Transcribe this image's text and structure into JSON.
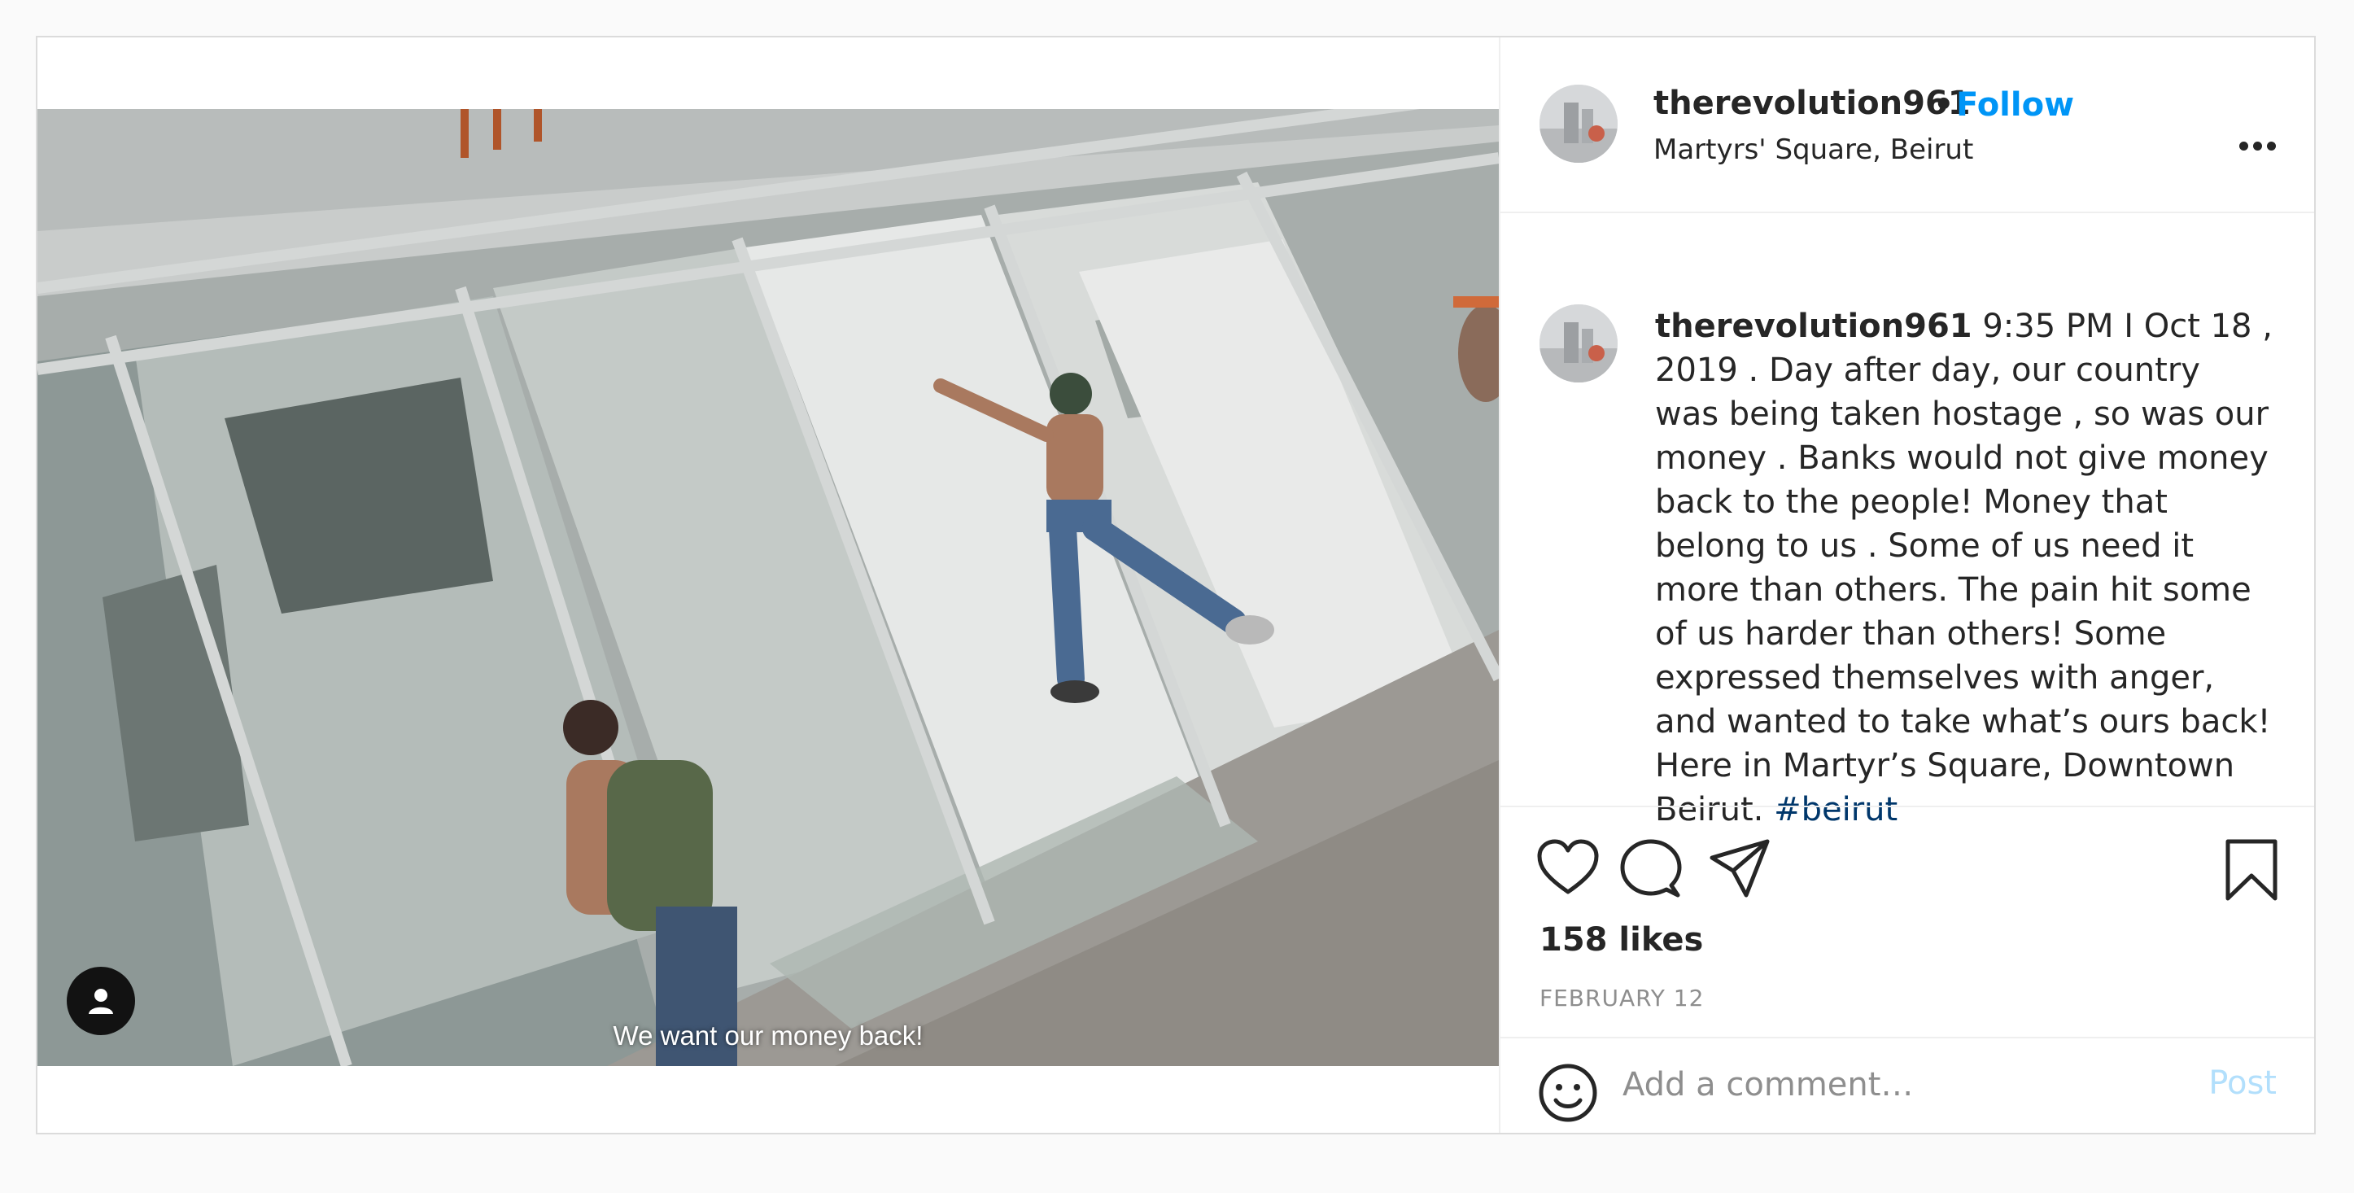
{
  "post": {
    "username": "therevolution961",
    "follow_label": "Follow",
    "dot": "•",
    "location": "Martyrs' Square, Beirut",
    "more_icon": "more-horizontal-icon",
    "image_overlay_text": "We want our money back!",
    "caption": {
      "username": "therevolution961",
      "text": " 9:35 PM I Oct 18 , 2019 . Day after day, our country was being taken hostage , so was our money . Banks would not give money back to the people! Money that belong to us . Some of us need it more than others. The pain hit some of us harder than others! Some expressed themselves with anger, and wanted to take what’s ours back! Here in Martyr’s Square, Downtown Beirut. ",
      "hashtag": "#beirut"
    },
    "likes": "158 likes",
    "date": "FEBRUARY 12",
    "comment_placeholder": "Add a comment…",
    "post_button": "Post"
  },
  "colors": {
    "follow": "#0095f6",
    "hashtag": "#00376b",
    "muted": "#8e8e8e",
    "post_disabled": "#b2dffc"
  }
}
